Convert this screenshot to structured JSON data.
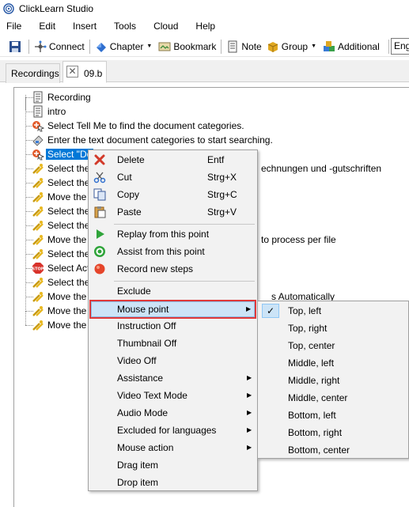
{
  "window": {
    "title": "ClickLearn Studio"
  },
  "menubar": [
    "File",
    "Edit",
    "Insert",
    "Tools",
    "Cloud",
    "Help"
  ],
  "toolbar": {
    "connect": "Connect",
    "chapter": "Chapter",
    "bookmark": "Bookmark",
    "note": "Note",
    "group": "Group",
    "additional": "Additional",
    "language": "Eng"
  },
  "tabs": {
    "recordings": "Recordings",
    "active": "09.b"
  },
  "tree": [
    {
      "icon": "document-icon",
      "text": "Recording"
    },
    {
      "icon": "document-icon",
      "text": "intro"
    },
    {
      "icon": "click-step-icon",
      "text": "Select Tell Me to find the document categories."
    },
    {
      "icon": "type-step-icon",
      "text": "Enter the text document categories to start searching."
    },
    {
      "icon": "click-step-icon",
      "text": "Select \"Do",
      "selected": true
    },
    {
      "icon": "key-step-icon",
      "text": "Select the",
      "tail": "echnungen und -gutschriften"
    },
    {
      "icon": "key-step-icon",
      "text": "Select the"
    },
    {
      "icon": "key-step-icon",
      "text": "Move the"
    },
    {
      "icon": "key-step-icon",
      "text": "Select the"
    },
    {
      "icon": "key-step-icon",
      "text": "Select the"
    },
    {
      "icon": "key-step-icon",
      "text": "Move the",
      "tail": "to process per file"
    },
    {
      "icon": "key-step-icon",
      "text": "Select the"
    },
    {
      "icon": "stop-icon",
      "text": "Select Act"
    },
    {
      "icon": "key-step-icon",
      "text": "Select the"
    },
    {
      "icon": "key-step-icon",
      "text": "Move the",
      "tail": "s Automatically"
    },
    {
      "icon": "key-step-icon",
      "text": "Move the"
    },
    {
      "icon": "key-step-icon",
      "text": "Move the"
    }
  ],
  "context_menu": {
    "delete": {
      "label": "Delete",
      "shortcut": "Entf"
    },
    "cut": {
      "label": "Cut",
      "shortcut": "Strg+X"
    },
    "copy": {
      "label": "Copy",
      "shortcut": "Strg+C"
    },
    "paste": {
      "label": "Paste",
      "shortcut": "Strg+V"
    },
    "replay": "Replay from this point",
    "assist": "Assist from this point",
    "record": "Record new steps",
    "exclude": "Exclude",
    "mouse_point": "Mouse point",
    "instruction_off": "Instruction Off",
    "thumbnail_off": "Thumbnail Off",
    "video_off": "Video Off",
    "assistance": "Assistance",
    "video_text_mode": "Video Text Mode",
    "audio_mode": "Audio Mode",
    "excluded_languages": "Excluded for languages",
    "mouse_action": "Mouse action",
    "drag_item": "Drag item",
    "drop_item": "Drop item"
  },
  "submenu": {
    "checked_index": 0,
    "check_mark": "✓",
    "items": [
      "Top, left",
      "Top, right",
      "Top, center",
      "Middle, left",
      "Middle, right",
      "Middle, center",
      "Bottom, left",
      "Bottom, right",
      "Bottom, center"
    ]
  }
}
